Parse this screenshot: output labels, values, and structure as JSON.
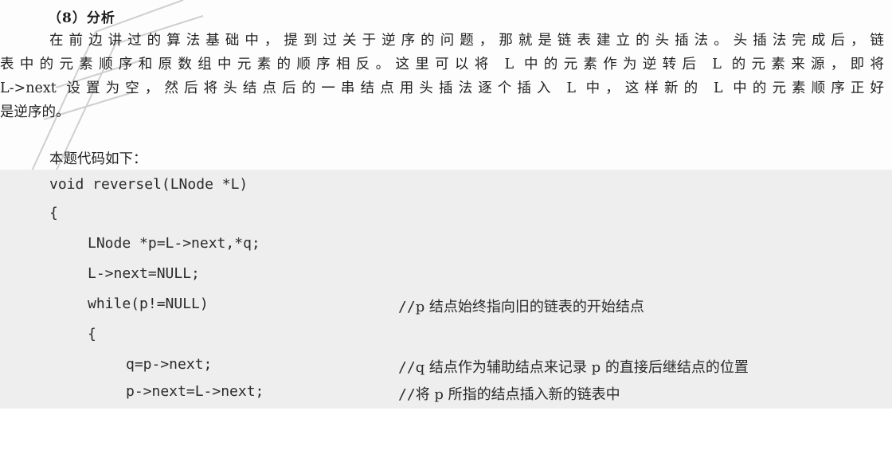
{
  "heading": "（8）分析",
  "paragraph": {
    "lines": [
      "在前边讲过的算法基础中，提到过关于逆序的问题，那就是链表建立的头插法。头插法完成后，链",
      "表中的元素顺序和原数组中元素的顺序相反。这里可以将 L 中的元素作为逆转后 L 的元素来源，即将",
      "L->next 设置为空，然后将头结点后的一串结点用头插法逐个插入 L 中，这样新的 L 中的元素顺序正好",
      "是逆序的。"
    ]
  },
  "intro": "本题代码如下：",
  "code": [
    {
      "text": "void reversel(LNode *L)",
      "comment": ""
    },
    {
      "text": "{",
      "comment": ""
    },
    {
      "text": "LNode *p=L->next,*q;",
      "comment": ""
    },
    {
      "text": "L->next=NULL;",
      "comment": ""
    },
    {
      "text": "while(p!=NULL)",
      "comment": "p 结点始终指向旧的链表的开始结点"
    },
    {
      "text": "{",
      "comment": ""
    },
    {
      "text": "q=p->next;",
      "comment": "q 结点作为辅助结点来记录 p 的直接后继结点的位置"
    },
    {
      "text": "p->next=L->next;",
      "comment": "将 p 所指的结点插入新的链表中"
    }
  ],
  "comment_prefix": "//",
  "colors": {
    "code_background": "#eeeeee",
    "text": "#222222",
    "watermark": "#c8c8c8"
  }
}
